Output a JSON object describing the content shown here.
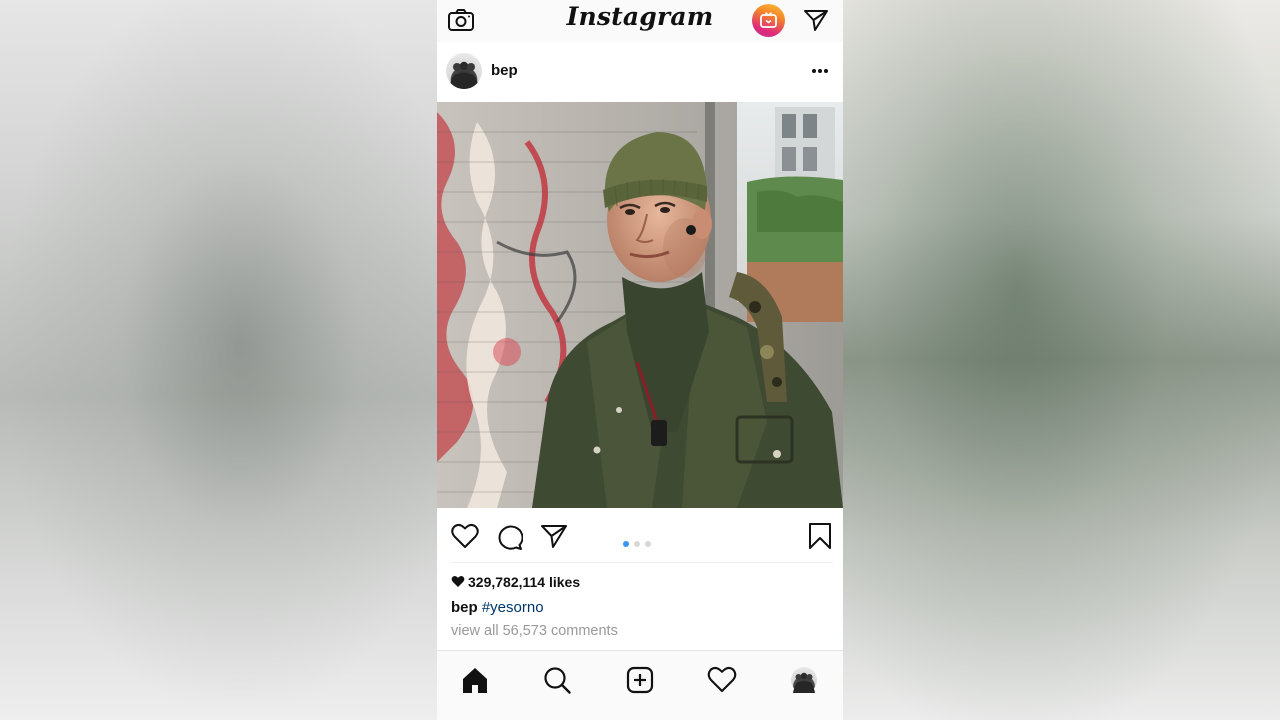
{
  "app": {
    "title": "Instagram"
  },
  "post": {
    "username": "bep",
    "likes": "329,782,114 likes",
    "caption_user": "bep",
    "caption_tag": "#yesorno",
    "comments_link": "view all 56,573 comments",
    "carousel": {
      "total": 3,
      "active": 1
    }
  },
  "icons": {
    "camera": "camera-icon",
    "igtv": "igtv-icon",
    "direct": "direct-message-icon",
    "more": "more-options-icon",
    "like": "heart-icon",
    "comment": "comment-icon",
    "share": "share-icon",
    "save": "bookmark-icon",
    "home": "home-icon",
    "search": "search-icon",
    "add": "add-post-icon",
    "activity": "activity-heart-icon",
    "profile": "profile-avatar"
  },
  "colors": {
    "active_dot": "#3897f0",
    "hashtag": "#003569",
    "muted_text": "#999999"
  }
}
